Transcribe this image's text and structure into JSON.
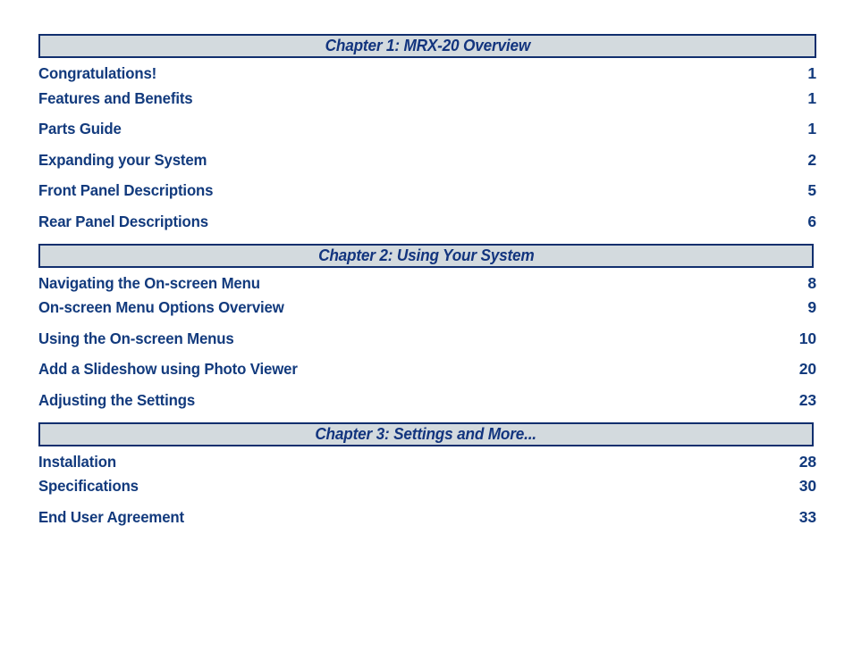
{
  "document": {
    "type": "table-of-contents",
    "background_color": "#ffffff",
    "text_color": "#123a7d",
    "bar_fill_color": "#d3dade",
    "bar_border_color": "#112f6e"
  },
  "chapters": [
    {
      "header": "Chapter 1: MRX-20 Overview",
      "entries": [
        {
          "title": "Congratulations!",
          "page": "1"
        },
        {
          "title": "Features and Benefits",
          "page": "1"
        },
        {
          "title": "Parts Guide",
          "page": "1"
        },
        {
          "title": "Expanding your System",
          "page": "2"
        },
        {
          "title": "Front Panel Descriptions",
          "page": "5"
        },
        {
          "title": "Rear Panel Descriptions",
          "page": "6"
        }
      ]
    },
    {
      "header": "Chapter 2: Using Your System",
      "entries": [
        {
          "title": "Navigating the On-screen Menu",
          "page": "8"
        },
        {
          "title": "On-screen Menu Options Overview",
          "page": "9"
        },
        {
          "title": "Using the On-screen Menus",
          "page": "10"
        },
        {
          "title": "Add a Slideshow using Photo Viewer",
          "page": "20"
        },
        {
          "title": "Adjusting the Settings",
          "page": "23"
        }
      ]
    },
    {
      "header": "Chapter 3: Settings and More...",
      "entries": [
        {
          "title": "Installation",
          "page": "28"
        },
        {
          "title": "Specifications",
          "page": "30"
        },
        {
          "title": "End User Agreement",
          "page": "33"
        }
      ]
    }
  ]
}
